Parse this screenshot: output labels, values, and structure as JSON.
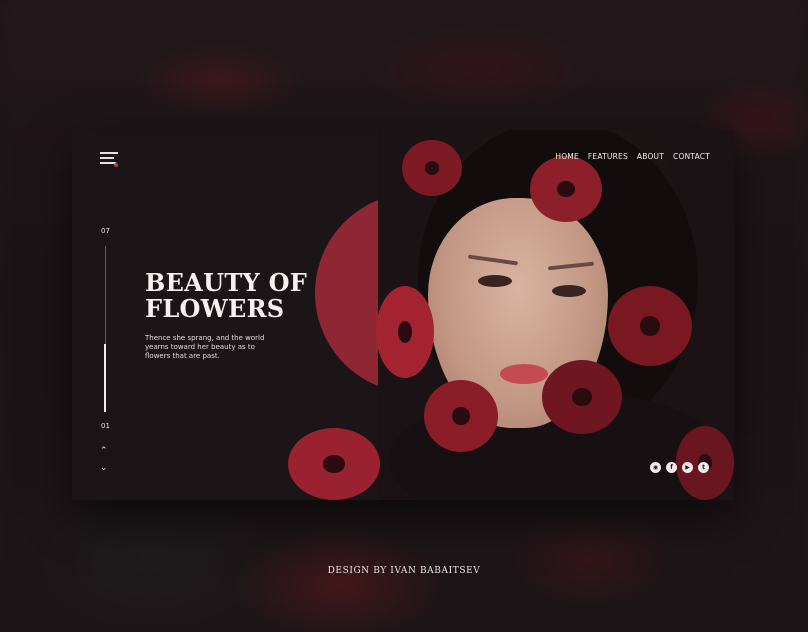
{
  "menu": {
    "icon": "hamburger-icon"
  },
  "nav": {
    "items": [
      {
        "label": "HOME"
      },
      {
        "label": "FEATURES"
      },
      {
        "label": "ABOUT"
      },
      {
        "label": "CONTACT"
      }
    ]
  },
  "slider": {
    "current": "07",
    "first": "01",
    "progress": 0.41,
    "up_icon": "chevron-up-icon",
    "down_icon": "chevron-down-icon"
  },
  "hero": {
    "title_line1": "BEAUTY OF",
    "title_line2": "FLOWERS",
    "description": "Thence she sprang, and the world yearns toward her beauty as to flowers that are past."
  },
  "social": {
    "icons": [
      "instagram-icon",
      "facebook-icon",
      "youtube-icon",
      "twitter-icon"
    ]
  },
  "credit": "DESIGN BY IVAN BABAITSEV",
  "colors": {
    "accent": "#8f2634",
    "background": "#1c1517",
    "text": "#f6f0f0"
  }
}
